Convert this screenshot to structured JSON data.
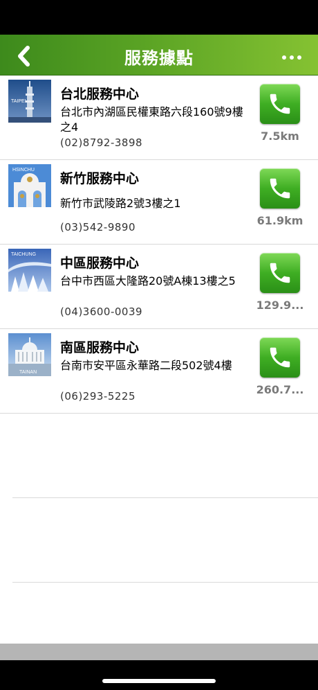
{
  "header": {
    "title": "服務據點",
    "back_icon": "chevron-left-icon",
    "more_icon": "more-horizontal-icon"
  },
  "colors": {
    "header_gradient_start": "#3d8a1c",
    "header_gradient_end": "#85c232",
    "call_button": "#3fae23",
    "distance_text": "#7a7a7a"
  },
  "locations": [
    {
      "city_label": "TAIPEI",
      "title": "台北服務中心",
      "address": "台北市內湖區民權東路六段160號9樓之4",
      "phone": "(02)8792-3898",
      "distance": "7.5km"
    },
    {
      "city_label": "HSINCHU",
      "title": "新竹服務中心",
      "address": "新竹市武陵路2號3樓之1",
      "phone": "(03)542-9890",
      "distance": "61.9km"
    },
    {
      "city_label": "TAICHUNG",
      "title": "中區服務中心",
      "address": "台中市西區大隆路20號A棟13樓之5",
      "phone": "(04)3600-0039",
      "distance": "129.9..."
    },
    {
      "city_label": "TAINAN",
      "title": "南區服務中心",
      "address": "台南市安平區永華路二段502號4樓",
      "phone": "(06)293-5225",
      "distance": "260.7..."
    }
  ]
}
